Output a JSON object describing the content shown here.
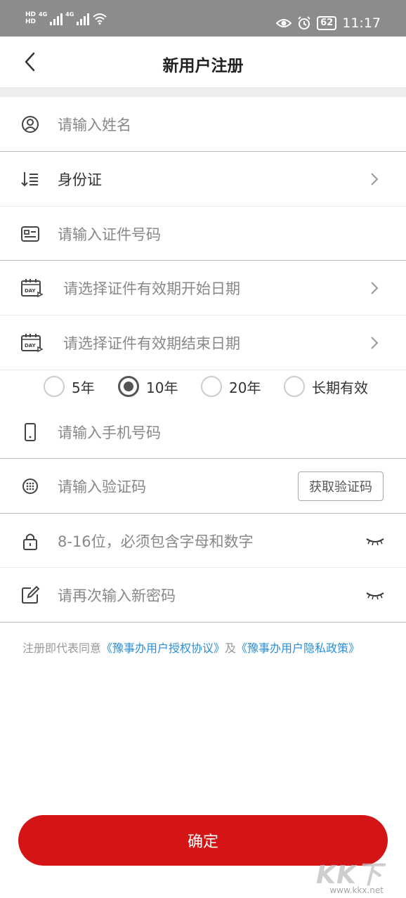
{
  "status_bar": {
    "hd1": "HD",
    "hd2": "HD",
    "net1": "4G",
    "net2": "4G",
    "battery": "62",
    "time": "11:17"
  },
  "nav": {
    "title": "新用户注册"
  },
  "form": {
    "name_placeholder": "请输入姓名",
    "id_type": "身份证",
    "id_number_placeholder": "请输入证件号码",
    "start_date_placeholder": "请选择证件有效期开始日期",
    "end_date_placeholder": "请选择证件有效期结束日期",
    "validity_options": [
      "5年",
      "10年",
      "20年",
      "长期有效"
    ],
    "validity_selected": "10年",
    "phone_placeholder": "请输入手机号码",
    "code_placeholder": "请输入验证码",
    "get_code_label": "获取验证码",
    "password_placeholder": "8-16位，必须包含字母和数字",
    "confirm_password_placeholder": "请再次输入新密码"
  },
  "agreement": {
    "prefix": "注册即代表同意",
    "link1": "《豫事办用户授权协议》",
    "conj": "及",
    "link2": "《豫事办用户隐私政策》"
  },
  "confirm_label": "确定",
  "watermark": {
    "text": "KK下载",
    "url": "www.kkx.net"
  },
  "colors": {
    "accent_red": "#d51515",
    "link_blue": "#2b8fd6",
    "status_bar": "#8c8c8c"
  }
}
